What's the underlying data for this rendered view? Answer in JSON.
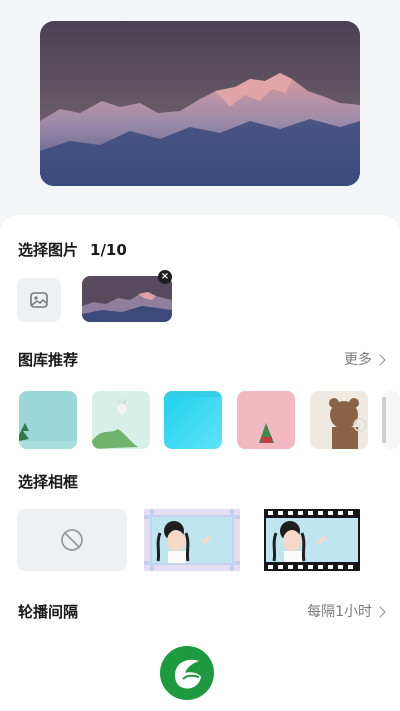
{
  "preview": {
    "image": "mountain-sunset-preview"
  },
  "select_images": {
    "title": "选择图片",
    "counter": "1/10"
  },
  "gallery": {
    "title": "图库推荐",
    "more_label": "更多",
    "items": [
      {
        "name": "teal-tree-card"
      },
      {
        "name": "green-cartoon-card"
      },
      {
        "name": "cyan-gradient-card"
      },
      {
        "name": "pink-zongzi-card"
      },
      {
        "name": "bear-card"
      }
    ]
  },
  "frames": {
    "title": "选择相框",
    "items": [
      {
        "name": "no-frame"
      },
      {
        "name": "plaid-frame"
      },
      {
        "name": "filmstrip-frame"
      }
    ]
  },
  "interval": {
    "title": "轮播间隔",
    "value": "每隔1小时"
  },
  "colors": {
    "brand_green": "#1d9a3f",
    "sheet_bg": "#ffffff",
    "page_bg": "#f4f5f7"
  }
}
